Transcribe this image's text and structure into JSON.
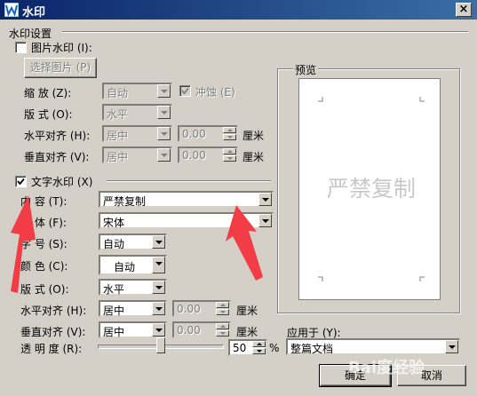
{
  "window": {
    "title": "水印",
    "close_label": "×"
  },
  "settings_group": "水印设置",
  "picture_watermark": {
    "label": "图片水印 (I):",
    "checked": false,
    "select_button": "选择图片 (P)",
    "scale_label": "缩    放 (Z):",
    "scale_value": "自动",
    "washout_label": "冲蚀 (E)",
    "layout_label": "版    式 (O):",
    "layout_value": "水平",
    "halign_label": "水平对齐 (H):",
    "halign_value": "居中",
    "halign_offset": "0.00",
    "valign_label": "垂直对齐 (V):",
    "valign_value": "居中",
    "valign_offset": "0.00",
    "unit": "厘米"
  },
  "text_watermark": {
    "label": "文字水印 (X)",
    "checked": true,
    "content_label": "内    容 (T):",
    "content_value": "严禁复制",
    "font_label": "字    体 (F):",
    "font_value": "宋体",
    "size_label": "字    号 (S):",
    "size_value": "自动",
    "color_label": "颜    色 (C):",
    "color_value": "自动",
    "layout_label": "版    式 (O):",
    "layout_value": "水平",
    "halign_label": "水平对齐 (H):",
    "halign_value": "居中",
    "halign_offset": "0.00",
    "valign_label": "垂直对齐 (V):",
    "valign_value": "居中",
    "valign_offset": "0.00",
    "unit": "厘米",
    "transparency_label": "透 明 度 (R):",
    "transparency_value": "50",
    "transparency_unit": "%",
    "transparency_fraction": 0.5
  },
  "preview": {
    "label": "预览",
    "watermark_text": "严禁复制"
  },
  "apply_to": {
    "label": "应用于 (Y):",
    "value": "整篇文档"
  },
  "buttons": {
    "ok": "确定",
    "cancel": "取消"
  },
  "overlay": {
    "site_watermark": "Bai度经验"
  },
  "colors": {
    "titlebar_start": "#0a246a",
    "titlebar_end": "#3a6ea5",
    "dialog_bg": "#d4d0c8",
    "annotation_arrow": "#f23c46"
  }
}
